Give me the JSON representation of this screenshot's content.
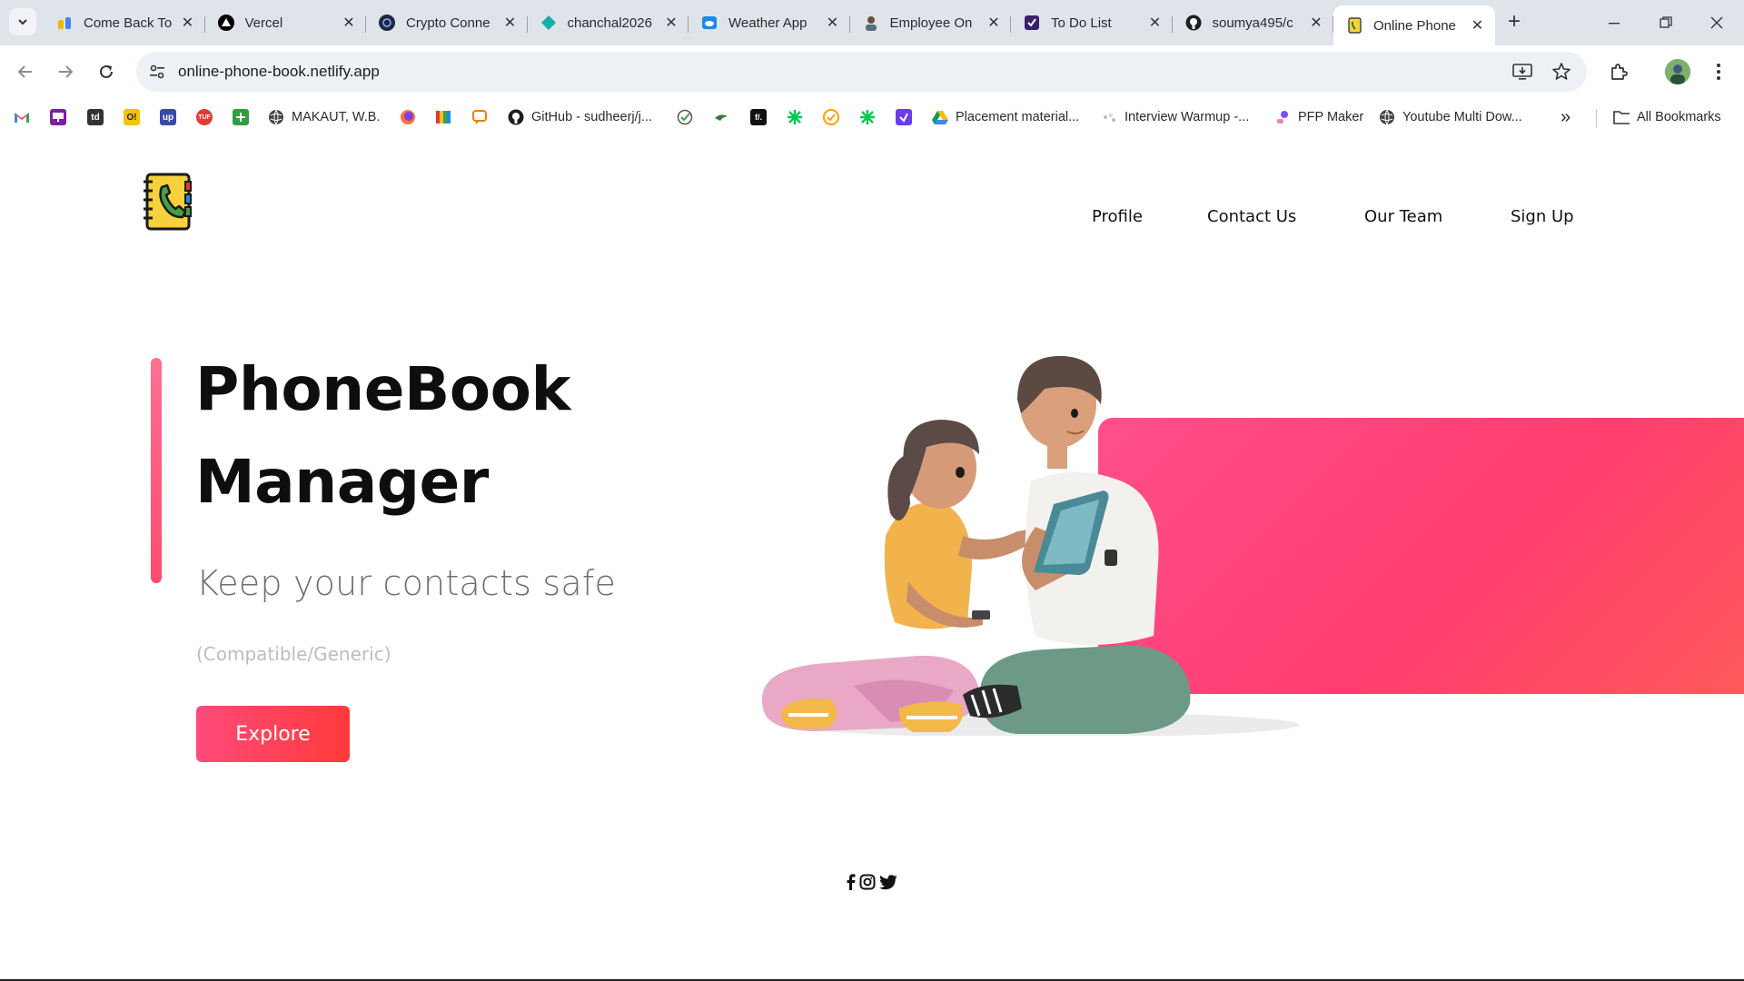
{
  "browser": {
    "tabs": [
      {
        "title": "Come Back To",
        "icon": "hands-icon"
      },
      {
        "title": "Vercel",
        "icon": "vercel-icon"
      },
      {
        "title": "Crypto Conne",
        "icon": "crypto-icon"
      },
      {
        "title": "chanchal2026",
        "icon": "diamond-icon"
      },
      {
        "title": "Weather App",
        "icon": "cloud-icon"
      },
      {
        "title": "Employee On",
        "icon": "employee-icon"
      },
      {
        "title": "To Do List",
        "icon": "todo-icon"
      },
      {
        "title": "soumya495/c",
        "icon": "github-icon"
      },
      {
        "title": "Online Phone",
        "icon": "phonebook-icon",
        "active": true
      }
    ],
    "new_tab_label": "+",
    "url": "online-phone-book.netlify.app",
    "bookmarks": [
      {
        "label": "",
        "icon": "gmail-icon"
      },
      {
        "label": "",
        "icon": "presentation-icon"
      },
      {
        "label": "",
        "icon": "td-icon",
        "text": "td"
      },
      {
        "label": "",
        "icon": "o-icon",
        "text": "O!"
      },
      {
        "label": "",
        "icon": "up-icon",
        "text": "up"
      },
      {
        "label": "",
        "icon": "tuf-icon",
        "text": "TUF"
      },
      {
        "label": "",
        "icon": "green-grid-icon"
      },
      {
        "label": "MAKAUT, W.B.",
        "icon": "globe-icon"
      },
      {
        "label": "",
        "icon": "firefox-icon"
      },
      {
        "label": "",
        "icon": "colorbars-icon"
      },
      {
        "label": "",
        "icon": "chat-icon"
      },
      {
        "label": "GitHub - sudheerj/j...",
        "icon": "github-icon"
      },
      {
        "label": "",
        "icon": "check-icon"
      },
      {
        "label": "",
        "icon": "bird-icon"
      },
      {
        "label": "",
        "icon": "code-icon",
        "text": "f/."
      },
      {
        "label": "",
        "icon": "asterisk-icon"
      },
      {
        "label": "",
        "icon": "orange-check-icon"
      },
      {
        "label": "",
        "icon": "asterisk2-icon"
      },
      {
        "label": "",
        "icon": "purple-icon"
      },
      {
        "label": "Placement material...",
        "icon": "drive-icon"
      },
      {
        "label": "Interview Warmup -...",
        "icon": "warmup-icon"
      },
      {
        "label": "PFP Maker",
        "icon": "pfp-icon"
      },
      {
        "label": "Youtube Multi Dow...",
        "icon": "globe-icon"
      }
    ],
    "more_label": "»",
    "all_bookmarks_label": "All Bookmarks"
  },
  "site": {
    "nav": [
      "Profile",
      "Contact Us",
      "Our Team",
      "Sign Up"
    ],
    "hero": {
      "title_line1": "PhoneBook",
      "title_line2": "Manager",
      "subtitle": "Keep your contacts safe",
      "note": "(Compatible/Generic)",
      "cta": "Explore"
    },
    "social": [
      "facebook-icon",
      "instagram-icon",
      "twitter-icon"
    ]
  },
  "colors": {
    "accent": "#ff4a6e",
    "tab_strip": "#dfe3ea",
    "omnibox": "#edf0f5"
  }
}
